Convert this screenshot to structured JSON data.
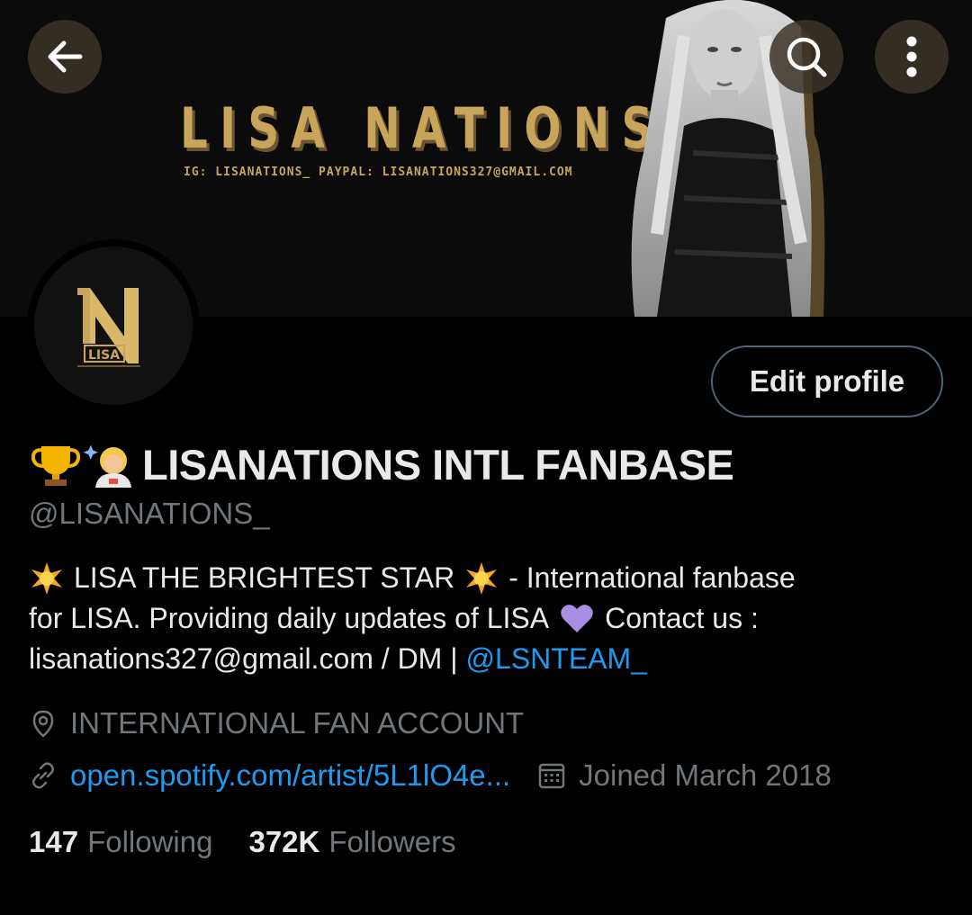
{
  "banner": {
    "title": "LISA NATIONS",
    "subtitle": "IG: LISANATIONS_  PAYPAL: LISANATIONS327@GMAIL.COM"
  },
  "top_bar": {
    "back_icon": "arrow-left-icon",
    "search_icon": "search-icon",
    "more_icon": "more-vertical-icon"
  },
  "avatar": {
    "logo_text": "LISA",
    "logo_letter": "N"
  },
  "actions": {
    "edit_profile_label": "Edit profile"
  },
  "profile": {
    "name_emojis": [
      "trophy-emoji",
      "woman-astronaut-emoji"
    ],
    "display_name": "LISANATIONS INTL FANBASE",
    "handle": "@LISANATIONS_"
  },
  "bio": {
    "line1_text": "LISA THE BRIGHTEST STAR",
    "line1_tail": "- International fanbase",
    "line2_text": "for LISA. Providing daily updates of LISA",
    "line2_tail": "Contact us :",
    "line3_text": "lisanations327@gmail.com / DM |",
    "line3_mention": "@LSNTEAM_"
  },
  "meta": {
    "location": "INTERNATIONAL FAN ACCOUNT",
    "website": "open.spotify.com/artist/5L1lO4e...",
    "joined": "Joined March 2018"
  },
  "stats": {
    "following_count": "147",
    "following_label": "Following",
    "followers_count": "372K",
    "followers_label": "Followers"
  },
  "colors": {
    "background": "#000000",
    "text_primary": "#e7e9ea",
    "text_secondary": "#71767b",
    "link": "#1d9bf0",
    "banner_gold": "#c9a55c"
  }
}
